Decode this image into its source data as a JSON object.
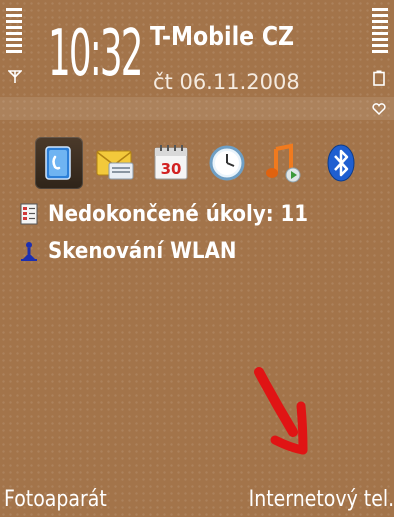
{
  "status": {
    "time": "10:32",
    "operator": "T-Mobile CZ",
    "date": "čt 06.11.2008",
    "signal_icon": "antenna-icon",
    "battery_icon": "battery-icon"
  },
  "shortcuts": [
    {
      "name": "contacts-icon"
    },
    {
      "name": "messaging-icon"
    },
    {
      "name": "calendar-icon",
      "label": "30"
    },
    {
      "name": "clock-icon"
    },
    {
      "name": "music-player-icon"
    },
    {
      "name": "bluetooth-icon"
    }
  ],
  "notifications": [
    {
      "text": "Nedokončené úkoly: 11",
      "icon": "todo-note-icon"
    },
    {
      "text": "Skenování WLAN",
      "icon": "wlan-scan-icon"
    }
  ],
  "softkeys": {
    "left": "Fotoaparát",
    "right": "Internetový tel."
  },
  "colors": {
    "background": "#a3744a",
    "text": "#ffffff",
    "arrow": "#e01414"
  }
}
